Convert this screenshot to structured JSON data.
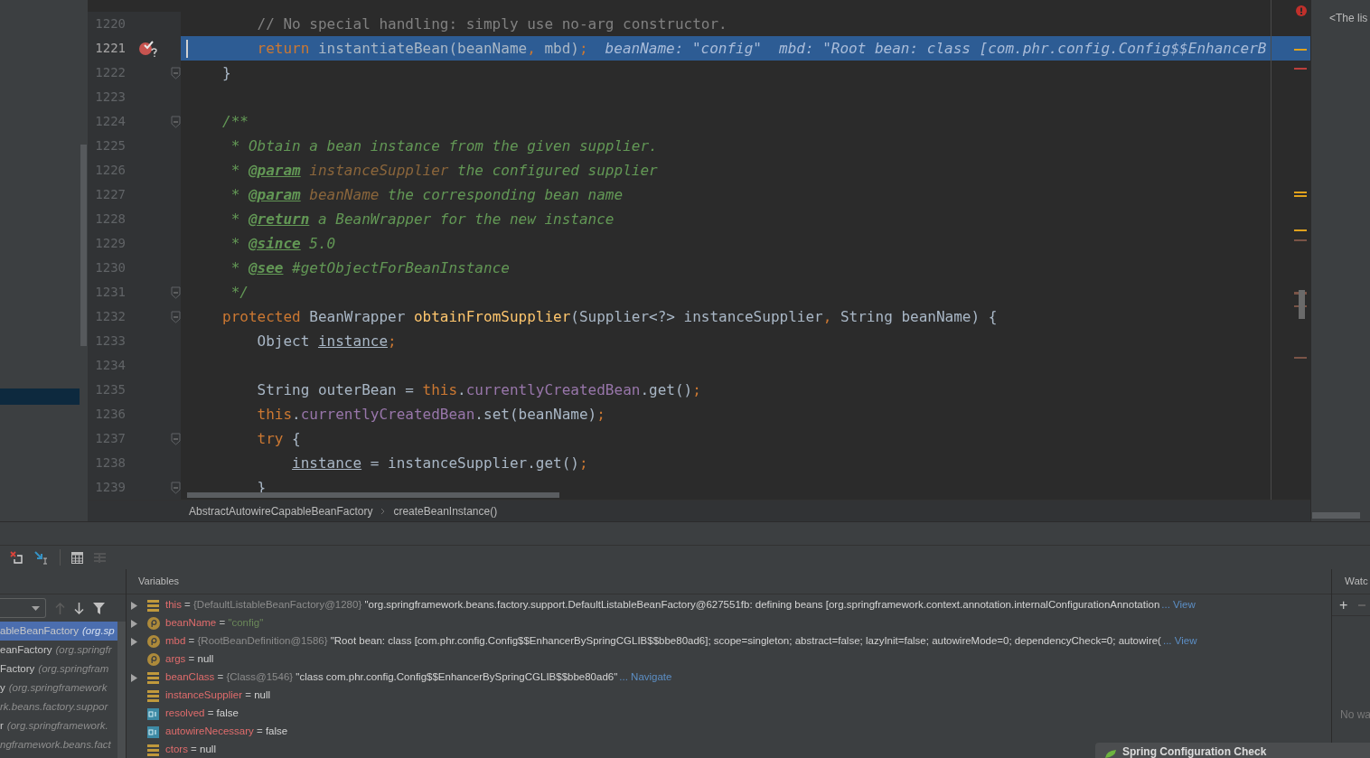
{
  "editor": {
    "lines": [
      {
        "number": "1220",
        "current": false,
        "breakpoint": false,
        "fold": false,
        "tokens": [
          {
            "kind": "comment",
            "text": "    // No special handling: simply use no-arg constructor."
          }
        ]
      },
      {
        "number": "1221",
        "current": true,
        "breakpoint": true,
        "fold": false,
        "tokens": [
          {
            "kind": "keyword",
            "text": "    return"
          },
          {
            "kind": "plain",
            "text": " instantiateBean(beanName"
          },
          {
            "kind": "keyword",
            "text": ","
          },
          {
            "kind": "plain",
            "text": " mbd)"
          },
          {
            "kind": "keyword",
            "text": ";"
          }
        ],
        "hints": [
          "beanName: \"config\"",
          "mbd: \"Root bean: class [com.phr.config.Config$$EnhancerB"
        ]
      },
      {
        "number": "1222",
        "current": false,
        "breakpoint": false,
        "fold": true,
        "tokens": [
          {
            "kind": "plain",
            "text": "}"
          }
        ]
      },
      {
        "number": "1223",
        "current": false,
        "breakpoint": false,
        "fold": false
      },
      {
        "number": "1224",
        "current": false,
        "breakpoint": false,
        "fold": true,
        "tokens": [
          {
            "kind": "doc",
            "text": "/**"
          }
        ]
      },
      {
        "number": "1225",
        "current": false,
        "breakpoint": false,
        "fold": false,
        "tokens": [
          {
            "kind": "doc",
            "text": " * Obtain a bean instance from the given supplier."
          }
        ]
      },
      {
        "number": "1226",
        "current": false,
        "breakpoint": false,
        "fold": false,
        "tokens": [
          {
            "kind": "doc",
            "text": " * "
          },
          {
            "kind": "doctag",
            "text": "@param"
          },
          {
            "kind": "docparam",
            "text": " instanceSupplier"
          },
          {
            "kind": "doc",
            "text": " the configured supplier"
          }
        ]
      },
      {
        "number": "1227",
        "current": false,
        "breakpoint": false,
        "fold": false,
        "tokens": [
          {
            "kind": "doc",
            "text": " * "
          },
          {
            "kind": "doctag",
            "text": "@param"
          },
          {
            "kind": "docparam",
            "text": " beanName"
          },
          {
            "kind": "doc",
            "text": " the corresponding bean name"
          }
        ]
      },
      {
        "number": "1228",
        "current": false,
        "breakpoint": false,
        "fold": false,
        "tokens": [
          {
            "kind": "doc",
            "text": " * "
          },
          {
            "kind": "doctag",
            "text": "@return"
          },
          {
            "kind": "doc",
            "text": " a BeanWrapper for the new instance"
          }
        ]
      },
      {
        "number": "1229",
        "current": false,
        "breakpoint": false,
        "fold": false,
        "tokens": [
          {
            "kind": "doc",
            "text": " * "
          },
          {
            "kind": "doctag",
            "text": "@since"
          },
          {
            "kind": "doc",
            "text": " 5.0"
          }
        ]
      },
      {
        "number": "1230",
        "current": false,
        "breakpoint": false,
        "fold": false,
        "tokens": [
          {
            "kind": "doc",
            "text": " * "
          },
          {
            "kind": "doctag",
            "text": "@see"
          },
          {
            "kind": "doc",
            "text": " #getObjectForBeanInstance"
          }
        ]
      },
      {
        "number": "1231",
        "current": false,
        "breakpoint": false,
        "fold": true,
        "tokens": [
          {
            "kind": "doc",
            "text": " */"
          }
        ]
      },
      {
        "number": "1232",
        "current": false,
        "breakpoint": false,
        "fold": true,
        "tokens": [
          {
            "kind": "keyword",
            "text": "protected"
          },
          {
            "kind": "plain",
            "text": " BeanWrapper "
          },
          {
            "kind": "method",
            "text": "obtainFromSupplier"
          },
          {
            "kind": "plain",
            "text": "(Supplier<?> instanceSupplier"
          },
          {
            "kind": "keyword",
            "text": ","
          },
          {
            "kind": "plain",
            "text": " String beanName) {"
          }
        ]
      },
      {
        "number": "1233",
        "current": false,
        "breakpoint": false,
        "fold": false,
        "tokens": [
          {
            "kind": "plain",
            "text": "    Object "
          },
          {
            "kind": "variable",
            "text": "instance"
          },
          {
            "kind": "keyword",
            "text": ";"
          }
        ]
      },
      {
        "number": "1234",
        "current": false,
        "breakpoint": false,
        "fold": false
      },
      {
        "number": "1235",
        "current": false,
        "breakpoint": false,
        "fold": false,
        "tokens": [
          {
            "kind": "plain",
            "text": "    String outerBean = "
          },
          {
            "kind": "keyword",
            "text": "this"
          },
          {
            "kind": "plain",
            "text": "."
          },
          {
            "kind": "field",
            "text": "currentlyCreatedBean"
          },
          {
            "kind": "plain",
            "text": ".get()"
          },
          {
            "kind": "keyword",
            "text": ";"
          }
        ]
      },
      {
        "number": "1236",
        "current": false,
        "breakpoint": false,
        "fold": false,
        "tokens": [
          {
            "kind": "keyword",
            "text": "    this"
          },
          {
            "kind": "plain",
            "text": "."
          },
          {
            "kind": "field",
            "text": "currentlyCreatedBean"
          },
          {
            "kind": "plain",
            "text": ".set(beanName)"
          },
          {
            "kind": "keyword",
            "text": ";"
          }
        ]
      },
      {
        "number": "1237",
        "current": false,
        "breakpoint": false,
        "fold": true,
        "tokens": [
          {
            "kind": "keyword",
            "text": "    try"
          },
          {
            "kind": "plain",
            "text": " {"
          }
        ]
      },
      {
        "number": "1238",
        "current": false,
        "breakpoint": false,
        "fold": false,
        "tokens": [
          {
            "kind": "variable",
            "text": "        instance"
          },
          {
            "kind": "plain",
            "text": " = instanceSupplier.get()"
          },
          {
            "kind": "keyword",
            "text": ";"
          }
        ]
      },
      {
        "number": "1239",
        "current": false,
        "breakpoint": false,
        "fold": true,
        "tokens": [
          {
            "kind": "plain",
            "text": "    }"
          }
        ]
      }
    ],
    "breadcrumbs": [
      "AbstractAutowireCapableBeanFactory",
      "createBeanInstance()"
    ]
  },
  "side_panel": {
    "text": "<The lis"
  },
  "frames": {
    "items": [
      {
        "method": "ableBeanFactory",
        "location": "(org.sp",
        "selected": true
      },
      {
        "method": "eanFactory",
        "location": "(org.springfr",
        "selected": false
      },
      {
        "method": "Factory",
        "location": "(org.springfram",
        "selected": false
      },
      {
        "method": "y",
        "location": "(org.springframework",
        "selected": false
      },
      {
        "location": "rk.beans.factory.suppor",
        "selected": false
      },
      {
        "method": "r",
        "location": "(org.springframework.",
        "selected": false
      },
      {
        "location": "ngframework.beans.fact",
        "selected": false
      }
    ]
  },
  "variables": {
    "title": "Variables",
    "items": [
      {
        "expandable": true,
        "kind": "field",
        "name": "this",
        "operator": "=",
        "ref": "{DefaultListableBeanFactory@1280}",
        "value": "\"org.springframework.beans.factory.support.DefaultListableBeanFactory@627551fb: defining beans [org.springframework.context.annotation.internalConfigurationAnnotation",
        "link": "... View"
      },
      {
        "expandable": true,
        "kind": "string",
        "name": "beanName",
        "operator": "=",
        "value": "\"config\""
      },
      {
        "expandable": true,
        "kind": "param",
        "name": "mbd",
        "operator": "=",
        "ref": "{RootBeanDefinition@1586}",
        "value": "\"Root bean: class [com.phr.config.Config$$EnhancerBySpringCGLIB$$bbe80ad6]; scope=singleton; abstract=false; lazyInit=false; autowireMode=0; dependencyCheck=0; autowire(",
        "link": "... View"
      },
      {
        "expandable": false,
        "kind": "param",
        "name": "args",
        "operator": "=",
        "value": "null"
      },
      {
        "expandable": true,
        "kind": "field",
        "name": "beanClass",
        "operator": "=",
        "ref": "{Class@1546}",
        "value": "\"class com.phr.config.Config$$EnhancerBySpringCGLIB$$bbe80ad6\"",
        "link": "... Navigate"
      },
      {
        "expandable": false,
        "kind": "field",
        "name": "instanceSupplier",
        "operator": "=",
        "value": "null"
      },
      {
        "expandable": false,
        "kind": "primitive",
        "name": "resolved",
        "operator": "=",
        "value": "false"
      },
      {
        "expandable": false,
        "kind": "primitive",
        "name": "autowireNecessary",
        "operator": "=",
        "value": "false"
      },
      {
        "expandable": false,
        "kind": "field",
        "name": "ctors",
        "operator": "=",
        "value": "null"
      }
    ]
  },
  "watches": {
    "tab": "Watc",
    "add": "+",
    "empty_text": "No wa"
  },
  "notification": {
    "title": "Spring Configuration Check"
  }
}
